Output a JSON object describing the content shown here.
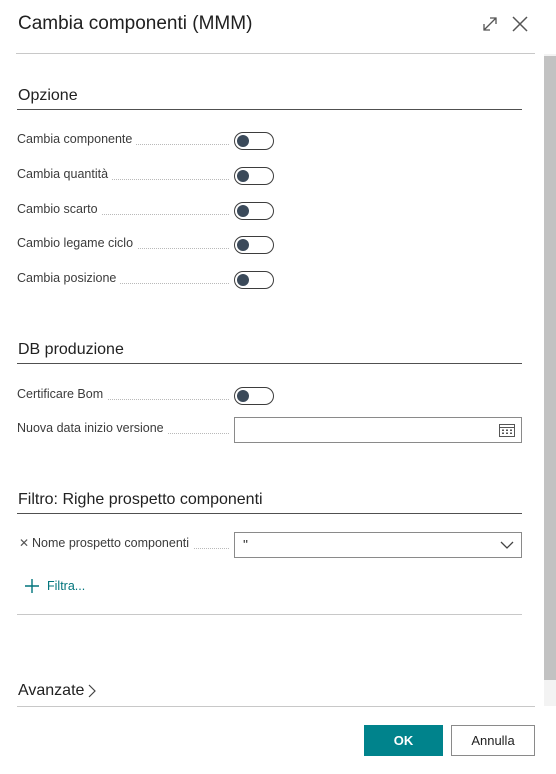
{
  "dialog": {
    "title": "Cambia componenti (MMM)",
    "expand_icon": "expand-icon",
    "close_icon": "close-icon"
  },
  "sections": {
    "opzione": {
      "title": "Opzione",
      "fields": [
        {
          "label": "Cambia componente",
          "value": false
        },
        {
          "label": "Cambia quantità",
          "value": false
        },
        {
          "label": "Cambio scarto",
          "value": false
        },
        {
          "label": "Cambio legame ciclo",
          "value": false
        },
        {
          "label": "Cambia posizione",
          "value": false
        }
      ]
    },
    "db_produzione": {
      "title": "DB produzione",
      "certify_label": "Certificare Bom",
      "certify_value": false,
      "date_label": "Nuova data inizio versione",
      "date_value": ""
    },
    "filtro": {
      "title": "Filtro: Righe prospetto componenti",
      "filter_label": "Nome prospetto componenti",
      "filter_value": "''",
      "add_filter_label": "Filtra..."
    },
    "avanzate": {
      "title": "Avanzate"
    }
  },
  "buttons": {
    "ok": "OK",
    "cancel": "Annulla"
  },
  "colors": {
    "accent": "#00838c",
    "link": "#00747c"
  }
}
